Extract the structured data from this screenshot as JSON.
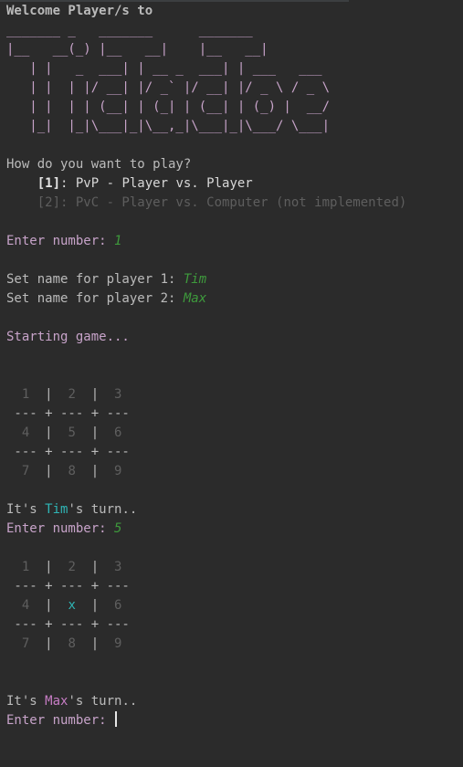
{
  "welcome": "Welcome Player/s to",
  "ascii_art": [
    "_______ _   _______      _______",
    "|__   __(_) |__   __|    |__   __|",
    "   | |   _  ___| | __ _  ___| | ___   ___",
    "   | |  | |/ __| |/ _` |/ __| |/ _ \\ / _ \\",
    "   | |  | | (__| | (_| | (__| | (_) |  __/",
    "   |_|  |_|\\___|_|\\__,_|\\___|_|\\___/ \\___|"
  ],
  "menu": {
    "question": "How do you want to play?",
    "opt1_key": "[1]",
    "opt1_text": ": PvP - Player vs. Player",
    "opt2": "[2]: PvC - Player vs. Computer (not implemented)"
  },
  "prompts": {
    "enter_number": "Enter number: ",
    "name1": "Set name for player 1: ",
    "name2": "Set name for player 2: ",
    "starting": "Starting game..."
  },
  "inputs": {
    "mode": "1",
    "player1": "Tim",
    "player2": "Max",
    "move1": "5"
  },
  "board": {
    "sep": " --- + --- + ---",
    "pipe": "|"
  },
  "board1": [
    [
      "1",
      "2",
      "3"
    ],
    [
      "4",
      "5",
      "6"
    ],
    [
      "7",
      "8",
      "9"
    ]
  ],
  "board2": [
    [
      "1",
      "2",
      "3"
    ],
    [
      "4",
      "x",
      "6"
    ],
    [
      "7",
      "8",
      "9"
    ]
  ],
  "turn": {
    "prefix": "It's ",
    "suffix": "'s turn.."
  },
  "colors": {
    "background": "#2b2b2b",
    "text": "#bbbbbb",
    "purple": "#c7a3c9",
    "green_input": "#3e9a3c",
    "player1": "#2fb5b5",
    "player2": "#c77dc5"
  }
}
